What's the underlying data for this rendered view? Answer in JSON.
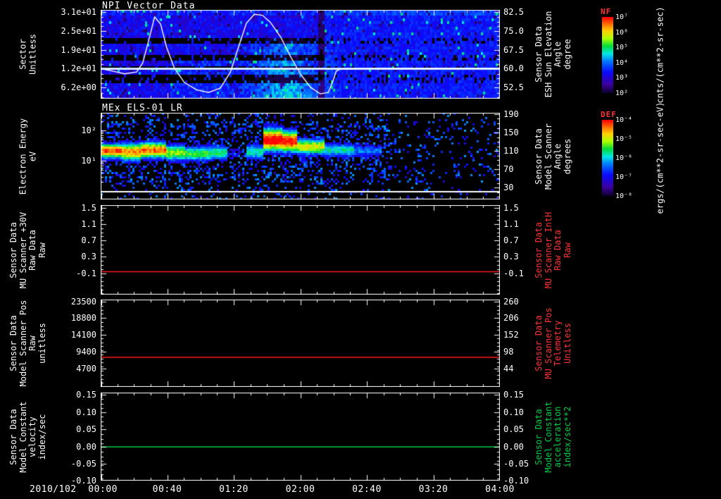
{
  "xaxis": {
    "labels": [
      "2010/102  00:00",
      "00:40",
      "01:20",
      "02:00",
      "02:40",
      "03:20",
      "04:00"
    ],
    "date": "2010/102"
  },
  "panels": [
    {
      "title": "NPI Vector Data",
      "kind": "spectro1",
      "left": {
        "lines": [
          "Sector",
          "Unitless"
        ],
        "lines_color": "#ffffff",
        "ticks": [
          "3.1e+01",
          "2.5e+01",
          "1.9e+01",
          "1.2e+01",
          "6.2e+00"
        ],
        "fracs": [
          0.024,
          0.238,
          0.452,
          0.659,
          0.873
        ]
      },
      "right": {
        "lines": [
          "Sensor Data",
          "ESH Sun Elevation",
          "Angle",
          "degree"
        ],
        "lines_color": "#ffffff",
        "ticks": [
          "82.5",
          "75.0",
          "67.5",
          "60.0",
          "52.5"
        ],
        "fracs": [
          0.024,
          0.238,
          0.452,
          0.659,
          0.873
        ]
      }
    },
    {
      "title": "MEx ELS-01 LR",
      "kind": "spectro2",
      "left": {
        "lines": [
          "Electron Energy",
          "eV"
        ],
        "lines_color": "#ffffff",
        "ticks": [
          "10²",
          "10¹"
        ],
        "fracs": [
          0.203,
          0.553
        ],
        "log": true
      },
      "right": {
        "lines": [
          "Sensor Data",
          "Model Scanner",
          "Angle",
          "degrees"
        ],
        "lines_color": "#ffffff",
        "ticks": [
          "190",
          "150",
          "110",
          "70",
          "30"
        ],
        "fracs": [
          0.016,
          0.228,
          0.439,
          0.65,
          0.862
        ]
      }
    },
    {
      "kind": "line",
      "line_color": "#ff1a1a",
      "line_frac": 0.744,
      "left": {
        "lines": [
          "Sensor Data",
          "MU Scanner +30V",
          "Raw Data",
          "Raw"
        ],
        "lines_color": "#ffffff",
        "ticks": [
          "1.5",
          "1.1",
          "0.7",
          "0.3",
          "-0.1"
        ],
        "fracs": [
          0.031,
          0.213,
          0.394,
          0.575,
          0.764
        ]
      },
      "right": {
        "lines": [
          "Sensor Data",
          "MU Scanner IntH",
          "Raw Data",
          "Raw"
        ],
        "lines_color": "#ff3333",
        "ticks": [
          "1.5",
          "1.1",
          "0.7",
          "0.3",
          "-0.1"
        ],
        "fracs": [
          0.031,
          0.213,
          0.394,
          0.575,
          0.764
        ]
      }
    },
    {
      "kind": "line",
      "line_color": "#ff1a1a",
      "line_frac": 0.661,
      "left": {
        "lines": [
          "Sensor Data",
          "Model Scanner Pos",
          "Raw",
          "unitless"
        ],
        "lines_color": "#ffffff",
        "ticks": [
          "23500",
          "18800",
          "14100",
          "9400",
          "4700"
        ],
        "fracs": [
          0.024,
          0.21,
          0.403,
          0.597,
          0.79
        ]
      },
      "right": {
        "lines": [
          "Sensor Data",
          "MU Scanner Pos",
          "Telemetry",
          "Unitless"
        ],
        "lines_color": "#ff3333",
        "ticks": [
          "260",
          "206",
          "152",
          "98",
          "44"
        ],
        "fracs": [
          0.024,
          0.21,
          0.403,
          0.597,
          0.79
        ]
      }
    },
    {
      "kind": "line",
      "line_color": "#00cc44",
      "line_frac": 0.616,
      "left": {
        "lines": [
          "Sensor Data",
          "Model Constant",
          "velocity",
          "index/sec"
        ],
        "lines_color": "#ffffff",
        "ticks": [
          "0.15",
          "0.10",
          "0.05",
          "0.00",
          "-0.05",
          "-0.10"
        ],
        "fracs": [
          0.024,
          0.224,
          0.416,
          0.616,
          0.808,
          1.0
        ]
      },
      "right": {
        "lines": [
          "Sensor Data",
          "Model Constant",
          "acceleration",
          "index/sec**2"
        ],
        "lines_color": "#00cc44",
        "ticks": [
          "0.15",
          "0.10",
          "0.05",
          "0.00",
          "-0.05",
          "-0.10"
        ],
        "fracs": [
          0.024,
          0.224,
          0.416,
          0.616,
          0.808,
          1.0
        ]
      }
    }
  ],
  "colorbars": [
    {
      "title": "NF",
      "title_color": "#ff3333",
      "ticks": [
        "10⁷",
        "10⁶",
        "10⁵",
        "10⁴",
        "10³",
        "10²"
      ],
      "units": "cnts/(cm**2-sr-sec)"
    },
    {
      "title": "DEF",
      "title_color": "#ff3333",
      "ticks": [
        "10⁻⁴",
        "10⁻⁵",
        "10⁻⁶",
        "10⁻⁷",
        "10⁻⁸"
      ],
      "units": "ergs/(cm**2-sr-sec-eV)"
    }
  ],
  "chart_data": [
    {
      "type": "heatmap",
      "title": "NPI Vector Data",
      "x_axis": {
        "start": "2010/102 00:00",
        "end": "04:00",
        "ticks": [
          "00:00",
          "00:40",
          "01:20",
          "02:00",
          "02:40",
          "03:20",
          "04:00"
        ]
      },
      "y_axis_left": {
        "label": "Sector Unitless",
        "tick_labels": [
          "3.1e+01",
          "2.5e+01",
          "1.9e+01",
          "1.2e+01",
          "6.2e+00"
        ]
      },
      "y_axis_right": {
        "label": "Sensor Data ESH Sun Elevation Angle degree",
        "ticks": [
          82.5,
          75.0,
          67.5,
          60.0,
          52.5
        ]
      },
      "colorbar": {
        "label": "NF",
        "units": "cnts/(cm**2-sr-sec)",
        "scale": "log",
        "tick_labels": [
          "10⁷",
          "10⁶",
          "10⁵",
          "10⁴",
          "10³",
          "10²"
        ]
      },
      "legend_position": "right",
      "grid": false,
      "description": "Blue/purple sector-vs-time spectrogram with dark horizontal dropout bands before ~02:40, a brighter cyan enhancement between ~01:20 and ~02:00, a bright white-blue horizontal stripe near sector 12, and an overlaid white sun-elevation curve peaking near 00:35 and 01:30 then flattening near 60 degrees"
    },
    {
      "type": "heatmap",
      "title": "MEx ELS-01 LR",
      "x_axis": {
        "start": "2010/102 00:00",
        "end": "04:00",
        "ticks": [
          "00:00",
          "00:40",
          "01:20",
          "02:00",
          "02:40",
          "03:20",
          "04:00"
        ]
      },
      "y_axis_left": {
        "label": "Electron Energy eV",
        "scale": "log",
        "tick_labels": [
          "10²",
          "10¹"
        ]
      },
      "y_axis_right": {
        "label": "Sensor Data Model Scanner Angle degrees",
        "ticks": [
          190,
          150,
          110,
          70,
          30
        ]
      },
      "colorbar": {
        "label": "DEF",
        "units": "ergs/(cm**2-sr-sec-eV)",
        "scale": "log",
        "tick_labels": [
          "10⁻⁴",
          "10⁻⁵",
          "10⁻⁶",
          "10⁻⁷",
          "10⁻⁸"
        ]
      },
      "legend_position": "right",
      "grid": false,
      "description": "Electron energy-time spectrogram: intense yellow/red band around 20-60 eV from 00:00 to ~00:45, green-cyan band to ~01:15, data gap near 01:20, strong red enhancement ~01:45-02:00 extending above 100 eV, fading cyan/blue band until ~02:45, sparse blue counts afterwards, solid white line near the bottom"
    },
    {
      "type": "line",
      "x_axis": {
        "start": "2010/102 00:00",
        "end": "04:00"
      },
      "series": [
        {
          "name": "Sensor Data MU Scanner IntH Raw Data Raw",
          "color": "#ff0000",
          "constant_value": 0.0
        }
      ],
      "y_axis_left": {
        "label": "Sensor Data MU Scanner +30V Raw Data Raw",
        "ticks": [
          1.5,
          1.1,
          0.7,
          0.3,
          -0.1
        ]
      },
      "y_axis_right": {
        "label": "Sensor Data MU Scanner IntH Raw Data Raw",
        "ticks": [
          1.5,
          1.1,
          0.7,
          0.3,
          -0.1
        ]
      },
      "grid": false
    },
    {
      "type": "line",
      "x_axis": {
        "start": "2010/102 00:00",
        "end": "04:00"
      },
      "series": [
        {
          "name": "Sensor Data MU Scanner Pos Telemetry Unitless",
          "color": "#ff0000",
          "constant_value": 8800
        }
      ],
      "y_axis_left": {
        "label": "Sensor Data Model Scanner Pos Raw unitless",
        "ticks": [
          23500,
          18800,
          14100,
          9400,
          4700
        ]
      },
      "y_axis_right": {
        "label": "Sensor Data MU Scanner Pos Telemetry Unitless",
        "ticks": [
          260,
          206,
          152,
          98,
          44
        ]
      },
      "grid": false
    },
    {
      "type": "line",
      "x_axis": {
        "start": "2010/102 00:00",
        "end": "04:00"
      },
      "series": [
        {
          "name": "Sensor Data Model Constant acceleration index/sec**2",
          "color": "#00cc44",
          "constant_value": 0.0
        }
      ],
      "y_axis_left": {
        "label": "Sensor Data Model Constant velocity index/sec",
        "ticks": [
          0.15,
          0.1,
          0.05,
          0.0,
          -0.05,
          -0.1
        ]
      },
      "y_axis_right": {
        "label": "Sensor Data Model Constant acceleration index/sec**2",
        "ticks": [
          0.15,
          0.1,
          0.05,
          0.0,
          -0.05,
          -0.1
        ]
      },
      "grid": false
    }
  ],
  "render": {
    "spectro1": {
      "dark_bands": [
        [
          0.29,
          0.38
        ],
        [
          0.48,
          0.565
        ],
        [
          0.615,
          0.655
        ],
        [
          0.72,
          0.8
        ]
      ],
      "bright_line_frac": 0.659,
      "curve": [
        [
          0,
          0.66
        ],
        [
          0.03,
          0.69
        ],
        [
          0.06,
          0.72
        ],
        [
          0.09,
          0.7
        ],
        [
          0.105,
          0.6
        ],
        [
          0.12,
          0.35
        ],
        [
          0.135,
          0.08
        ],
        [
          0.15,
          0.16
        ],
        [
          0.165,
          0.42
        ],
        [
          0.185,
          0.66
        ],
        [
          0.21,
          0.82
        ],
        [
          0.24,
          0.9
        ],
        [
          0.27,
          0.93
        ],
        [
          0.3,
          0.88
        ],
        [
          0.325,
          0.7
        ],
        [
          0.345,
          0.42
        ],
        [
          0.365,
          0.15
        ],
        [
          0.385,
          0.05
        ],
        [
          0.405,
          0.06
        ],
        [
          0.425,
          0.14
        ],
        [
          0.45,
          0.3
        ],
        [
          0.475,
          0.52
        ],
        [
          0.5,
          0.72
        ],
        [
          0.525,
          0.87
        ],
        [
          0.55,
          0.945
        ],
        [
          0.57,
          0.93
        ],
        [
          0.582,
          0.8
        ],
        [
          0.59,
          0.69
        ],
        [
          0.6,
          0.665
        ],
        [
          0.7,
          0.66
        ],
        [
          0.85,
          0.66
        ],
        [
          1,
          0.66
        ]
      ]
    },
    "spectro2": {
      "white_line_frac": 0.91,
      "segments": [
        {
          "x0": 0.0,
          "x1": 0.05,
          "a": 0.95,
          "c": 0.43,
          "w": 0.09
        },
        {
          "x0": 0.05,
          "x1": 0.1,
          "a": 0.88,
          "c": 0.44,
          "w": 0.11
        },
        {
          "x0": 0.1,
          "x1": 0.16,
          "a": 0.92,
          "c": 0.42,
          "w": 0.1
        },
        {
          "x0": 0.16,
          "x1": 0.21,
          "a": 0.72,
          "c": 0.45,
          "w": 0.1
        },
        {
          "x0": 0.21,
          "x1": 0.27,
          "a": 0.65,
          "c": 0.46,
          "w": 0.09
        },
        {
          "x0": 0.27,
          "x1": 0.315,
          "a": 0.6,
          "c": 0.45,
          "w": 0.09
        },
        {
          "x0": 0.315,
          "x1": 0.36,
          "a": 0.2,
          "c": 0.45,
          "w": 0.08
        },
        {
          "x0": 0.36,
          "x1": 0.405,
          "a": 0.55,
          "c": 0.44,
          "w": 0.1
        },
        {
          "x0": 0.405,
          "x1": 0.45,
          "a": 1.05,
          "c": 0.3,
          "w": 0.14
        },
        {
          "x0": 0.45,
          "x1": 0.49,
          "a": 1.0,
          "c": 0.32,
          "w": 0.13
        },
        {
          "x0": 0.49,
          "x1": 0.56,
          "a": 0.78,
          "c": 0.38,
          "w": 0.1
        },
        {
          "x0": 0.56,
          "x1": 0.63,
          "a": 0.55,
          "c": 0.42,
          "w": 0.09
        },
        {
          "x0": 0.63,
          "x1": 0.7,
          "a": 0.42,
          "c": 0.43,
          "w": 0.08
        },
        {
          "x0": 0.7,
          "x1": 1.01,
          "a": 0.12,
          "c": 0.43,
          "w": 0.07
        }
      ]
    }
  }
}
